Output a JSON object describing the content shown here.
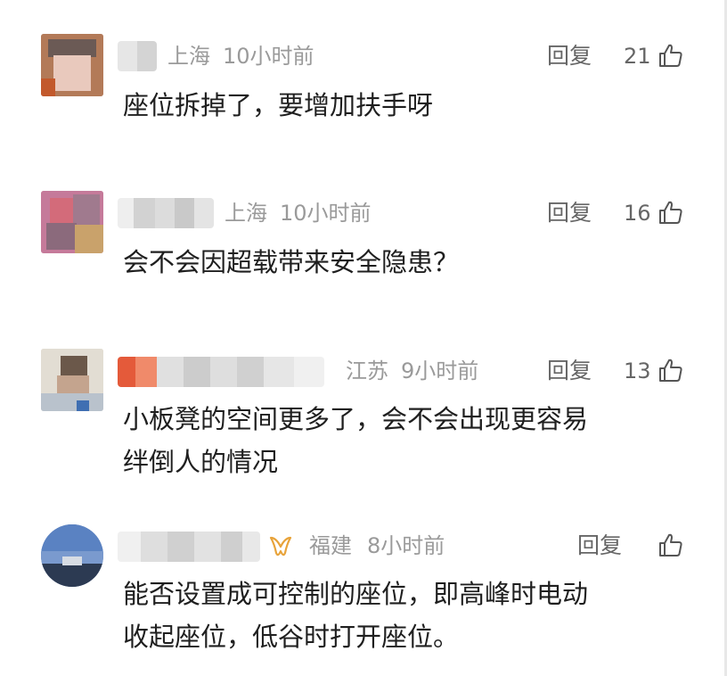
{
  "comments": [
    {
      "location": "上海",
      "time": "10小时前",
      "reply_label": "回复",
      "likes": "21",
      "lines": [
        "座位拆掉了，要增加扶手呀"
      ]
    },
    {
      "location": "上海",
      "time": "10小时前",
      "reply_label": "回复",
      "likes": "16",
      "lines": [
        "会不会因超载带来安全隐患？"
      ]
    },
    {
      "location": "江苏",
      "time": "9小时前",
      "reply_label": "回复",
      "likes": "13",
      "lines": [
        "小板凳的空间更多了，会不会出现更容易",
        "绊倒人的情况"
      ]
    },
    {
      "location": "福建",
      "time": "8小时前",
      "reply_label": "回复",
      "likes": "",
      "lines": [
        "能否设置成可控制的座位，即高峰时电动",
        "收起座位，低谷时打开座位。"
      ]
    }
  ],
  "icons": {
    "like": "thumbs-up-icon",
    "badge": "vip-badge-icon"
  },
  "colors": {
    "meta_text": "#9a9a9a",
    "reply_text": "#666666",
    "body_text": "#1f1f1f",
    "badge": "#e8a33a"
  }
}
